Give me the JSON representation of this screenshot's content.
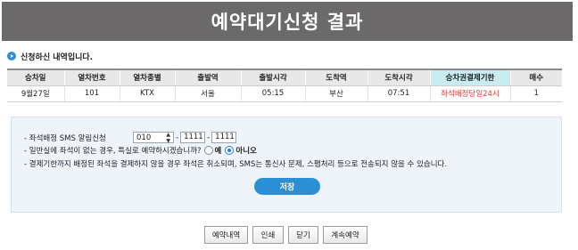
{
  "header": {
    "title": "예약대기신청 결과"
  },
  "section": {
    "title": "신청하신 내역입니다.",
    "icon": "bullet-arrow-icon"
  },
  "table": {
    "columns": [
      "승차일",
      "열차번호",
      "열차종별",
      "출발역",
      "출발시각",
      "도착역",
      "도착시각",
      "승차권결제기한",
      "매수"
    ],
    "rows": [
      [
        "9월27일",
        "101",
        "KTX",
        "서울",
        "05:15",
        "부산",
        "07:51",
        "좌석배정당일24시",
        "1"
      ]
    ],
    "highlight_color": "#c8ecf0",
    "deadline_color": "#e23a3a"
  },
  "sms": {
    "label": "- 좌석배정 SMS 알림신청",
    "prefix": "010",
    "middle": "1111",
    "last": "1111",
    "dash": "-"
  },
  "general_seat": {
    "label": "- 일반실에 좌석이 없는 경우, 특실로 예약하시겠습니까?",
    "yes": "예",
    "no": "아니오",
    "selected": "아니오"
  },
  "notice": "- 결제기한까지 배정된 좌석을 결제하지 않을 경우 좌석은 취소되며, SMS는 통신사 문제, 스팸처리 등으로 전송되지 않을 수 있습니다.",
  "save_label": "저장",
  "buttons": {
    "reservation": "예약내역",
    "print": "인쇄",
    "close": "닫기",
    "continue": "계속예약"
  },
  "colors": {
    "header_bg": "#6b6969",
    "accent": "#2b8fd5"
  }
}
